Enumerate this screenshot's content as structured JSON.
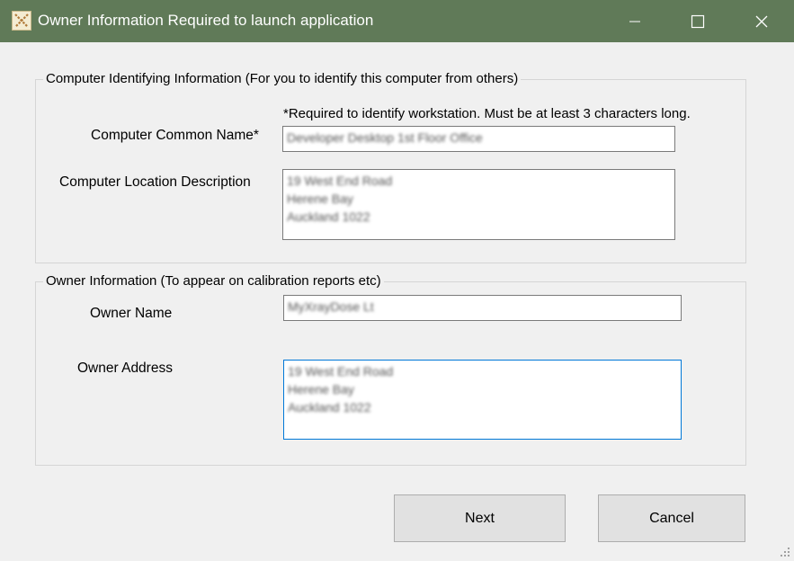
{
  "window": {
    "title": "Owner Information Required to launch application",
    "icon": "app-icon",
    "controls": [
      "minimize-icon",
      "maximize-icon",
      "close-icon"
    ]
  },
  "computer_group": {
    "legend": "Computer Identifying Information (For you to identify this computer from others)",
    "required_note": "*Required to identify workstation. Must be at least 3 characters long.",
    "common_name_label": "Computer Common Name*",
    "common_name_value": "Developer Desktop 1st Floor Office",
    "location_label": "Computer Location Description",
    "location_lines": [
      "19 West End Road",
      "Herene Bay",
      "Auckland 1022"
    ]
  },
  "owner_group": {
    "legend": "Owner Information (To appear on calibration reports etc)",
    "owner_name_label": "Owner Name",
    "owner_name_value": "MyXrayDose Lt",
    "owner_address_label": "Owner Address",
    "address_lines": [
      "19 West End Road",
      "Herene Bay",
      "Auckland 1022"
    ]
  },
  "buttons": {
    "next": "Next",
    "cancel": "Cancel"
  },
  "colors": {
    "titlebar": "#607a58",
    "focus_border": "#0078d7"
  }
}
